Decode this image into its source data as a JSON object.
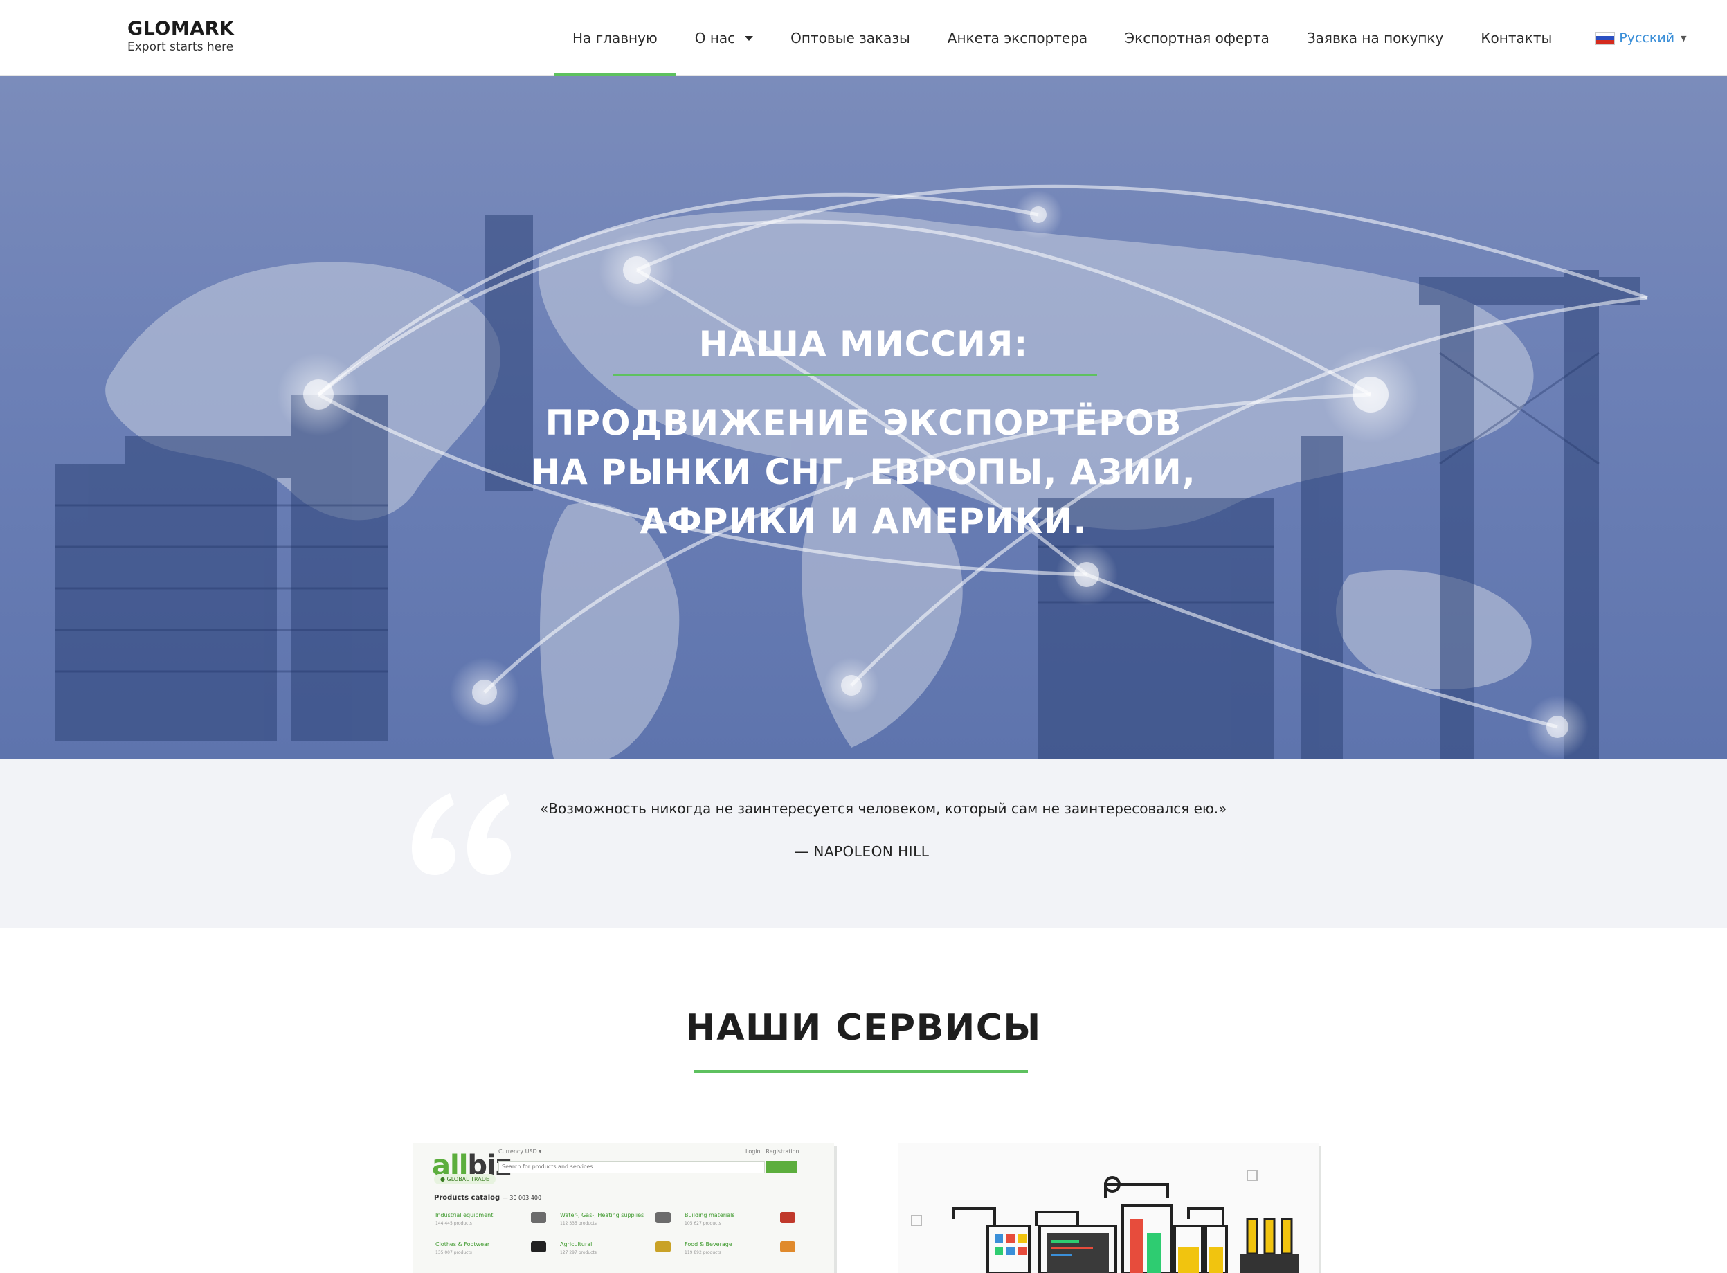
{
  "nav": {
    "logo_title": "GLOMARK",
    "logo_subtitle": "Export starts here",
    "items": [
      {
        "label": "На главную",
        "active": true
      },
      {
        "label": "О нас",
        "has_dropdown": true
      },
      {
        "label": "Оптовые заказы"
      },
      {
        "label": "Анкета экспортера"
      },
      {
        "label": "Экспортная оферта"
      },
      {
        "label": "Заявка на покупку"
      },
      {
        "label": "Контакты"
      }
    ],
    "language": {
      "label": "Русский",
      "flag_icon": "russia-flag-icon"
    },
    "accent_color": "#5ec15f"
  },
  "hero": {
    "heading": "НАША МИССИЯ:",
    "lines": [
      "ПРОДВИЖЕНИЕ ЭКСПОРТЁРОВ",
      "НА РЫНКИ СНГ, ЕВРОПЫ, АЗИИ,",
      "АФРИКИ И АМЕРИКИ."
    ],
    "tint_color": "#6a7fb5"
  },
  "quote": {
    "icon": "quote-mark-icon",
    "text": "«Возможность никогда не заинтересуется человеком, который сам не заинтересовался ею.»",
    "author": "— NAPOLEON HILL"
  },
  "services": {
    "title": "НАШИ СЕРВИСЫ",
    "card1": {
      "logo_a": "all",
      "logo_b": "biz",
      "tag": "● GLOBAL TRADE",
      "currency": "Currency USD ▾",
      "search_placeholder": "Search for products and services",
      "login": "Login | Registration",
      "catalog_title": "Products catalog",
      "catalog_count": "— 30 003 400",
      "categories": [
        {
          "name": "Industrial equipment",
          "count": "144 445 products"
        },
        {
          "name": "Water-, Gas-, Heating supplies",
          "count": "112 335 products"
        },
        {
          "name": "Building materials",
          "count": "105 627 products"
        },
        {
          "name": "Clothes & Footwear",
          "count": "135 007 products"
        },
        {
          "name": "Agricultural",
          "count": "127 297 products"
        },
        {
          "name": "Food & Beverage",
          "count": "119 892 products"
        }
      ]
    },
    "card2": {
      "illustration": "lab-equipment-illustration"
    }
  }
}
